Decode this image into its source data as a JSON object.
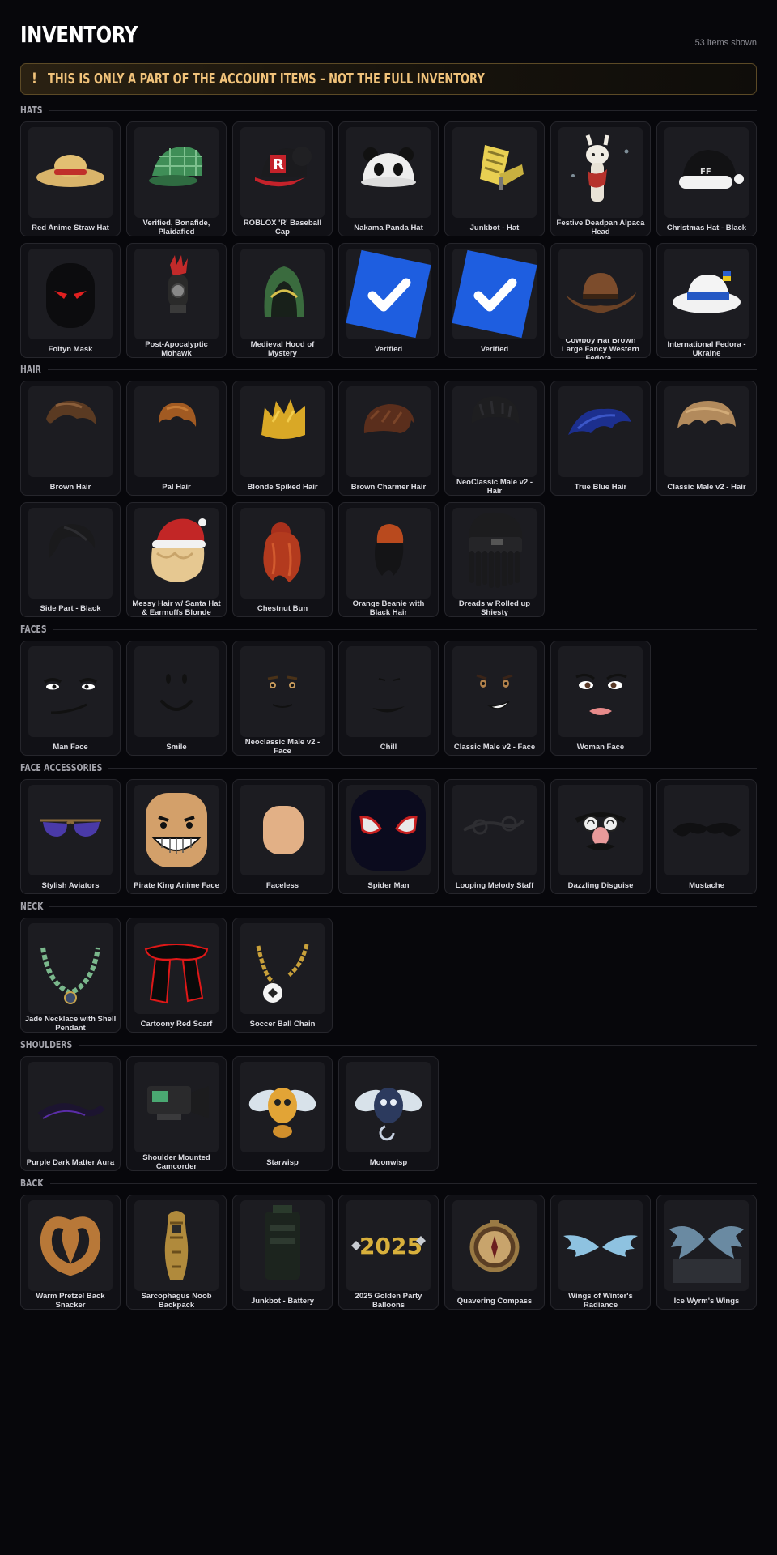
{
  "header": {
    "title": "INVENTORY",
    "count": "53 items shown"
  },
  "notice": {
    "icon": "!",
    "message": "THIS IS ONLY A PART OF THE ACCOUNT ITEMS – NOT THE FULL INVENTORY"
  },
  "sections": [
    {
      "id": "hats",
      "label": "HATS",
      "items": [
        {
          "name": "Red Anime Straw Hat",
          "icon": "straw-hat"
        },
        {
          "name": "Verified, Bonafide, Plaidafied",
          "icon": "plaid-cap"
        },
        {
          "name": "ROBLOX 'R' Baseball Cap",
          "icon": "r-cap"
        },
        {
          "name": "Nakama Panda Hat",
          "icon": "panda-hat"
        },
        {
          "name": "Junkbot - Hat",
          "icon": "junkbot-hat"
        },
        {
          "name": "Festive Deadpan Alpaca Head",
          "icon": "alpaca-head"
        },
        {
          "name": "Christmas Hat - Black",
          "icon": "christmas-hat"
        },
        {
          "name": "Foltyn Mask",
          "icon": "foltyn-mask"
        },
        {
          "name": "Post-Apocalyptic Mohawk",
          "icon": "mohawk"
        },
        {
          "name": "Medieval Hood of Mystery",
          "icon": "hood"
        },
        {
          "name": "Verified",
          "icon": "verified-badge"
        },
        {
          "name": "Verified",
          "icon": "verified-badge"
        },
        {
          "name": "Cowboy Hat Brown Large Fancy Western Fedora..",
          "icon": "cowboy-hat"
        },
        {
          "name": "International Fedora - Ukraine",
          "icon": "fedora"
        }
      ]
    },
    {
      "id": "hair",
      "label": "HAIR",
      "items": [
        {
          "name": "Brown Hair",
          "icon": "hair-brown"
        },
        {
          "name": "Pal Hair",
          "icon": "hair-pal"
        },
        {
          "name": "Blonde Spiked Hair",
          "icon": "hair-blonde"
        },
        {
          "name": "Brown Charmer Hair",
          "icon": "hair-charmer"
        },
        {
          "name": "NeoClassic Male v2 - Hair",
          "icon": "hair-neoclassic"
        },
        {
          "name": "True Blue Hair",
          "icon": "hair-blue"
        },
        {
          "name": "Classic Male v2 - Hair",
          "icon": "hair-classic"
        },
        {
          "name": "Side Part - Black",
          "icon": "hair-sidepart"
        },
        {
          "name": "Messy Hair w/ Santa Hat & Earmuffs Blonde",
          "icon": "hair-santa"
        },
        {
          "name": "Chestnut Bun",
          "icon": "hair-bun"
        },
        {
          "name": "Orange Beanie with Black Hair",
          "icon": "hair-beanie"
        },
        {
          "name": "Dreads w Rolled up Shiesty",
          "icon": "hair-dreads"
        }
      ]
    },
    {
      "id": "faces",
      "label": "FACES",
      "items": [
        {
          "name": "Man Face",
          "icon": "face-man"
        },
        {
          "name": "Smile",
          "icon": "face-smile"
        },
        {
          "name": "Neoclassic Male v2 - Face",
          "icon": "face-neoclassic"
        },
        {
          "name": "Chill",
          "icon": "face-chill"
        },
        {
          "name": "Classic Male v2 - Face",
          "icon": "face-classic"
        },
        {
          "name": "Woman Face",
          "icon": "face-woman"
        }
      ]
    },
    {
      "id": "face-accessories",
      "label": "FACE ACCESSORIES",
      "items": [
        {
          "name": "Stylish Aviators",
          "icon": "aviators"
        },
        {
          "name": "Pirate King Anime Face",
          "icon": "pirate-face"
        },
        {
          "name": "Faceless",
          "icon": "faceless-head"
        },
        {
          "name": "Spider Man",
          "icon": "spider-mask"
        },
        {
          "name": "Looping Melody Staff",
          "icon": "melody-staff"
        },
        {
          "name": "Dazzling Disguise",
          "icon": "disguise"
        },
        {
          "name": "Mustache",
          "icon": "mustache"
        }
      ]
    },
    {
      "id": "neck",
      "label": "NECK",
      "items": [
        {
          "name": "Jade Necklace with Shell Pendant",
          "icon": "jade-necklace"
        },
        {
          "name": "Cartoony Red Scarf",
          "icon": "red-scarf"
        },
        {
          "name": "Soccer Ball Chain",
          "icon": "soccer-chain"
        }
      ]
    },
    {
      "id": "shoulders",
      "label": "SHOULDERS",
      "items": [
        {
          "name": "Purple Dark Matter Aura",
          "icon": "dark-aura"
        },
        {
          "name": "Shoulder Mounted Camcorder",
          "icon": "camcorder"
        },
        {
          "name": "Starwisp",
          "icon": "starwisp"
        },
        {
          "name": "Moonwisp",
          "icon": "moonwisp"
        }
      ]
    },
    {
      "id": "back",
      "label": "BACK",
      "items": [
        {
          "name": "Warm Pretzel Back Snacker",
          "icon": "pretzel"
        },
        {
          "name": "Sarcophagus Noob Backpack",
          "icon": "sarcophagus"
        },
        {
          "name": "Junkbot - Battery",
          "icon": "battery"
        },
        {
          "name": "2025 Golden Party Balloons",
          "icon": "balloons-2025"
        },
        {
          "name": "Quavering Compass",
          "icon": "compass"
        },
        {
          "name": "Wings of Winter's Radiance",
          "icon": "winter-wings"
        },
        {
          "name": "Ice Wyrm's Wings",
          "icon": "wyrm-wings"
        }
      ]
    }
  ]
}
